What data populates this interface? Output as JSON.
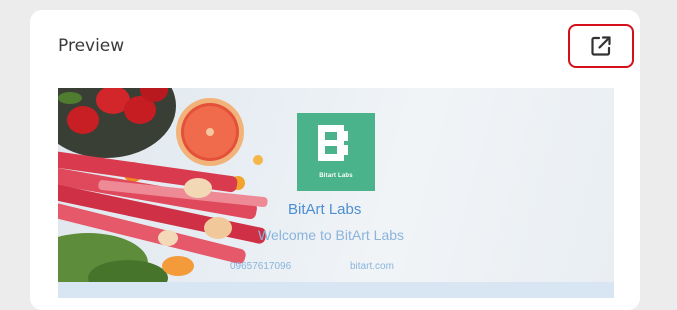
{
  "card": {
    "title": "Preview",
    "open_icon": "external-link-icon"
  },
  "preview": {
    "logo_text": "Bitart Labs",
    "brand_name": "BitArt Labs",
    "welcome": "Welcome to BitArt Labs",
    "phone": "09657617096",
    "website": "bitart.com"
  },
  "colors": {
    "highlight": "#d6101a",
    "logo_bg": "#4bb38c",
    "brand_text": "#4d8fd0",
    "sub_text": "#8ab4dc"
  }
}
